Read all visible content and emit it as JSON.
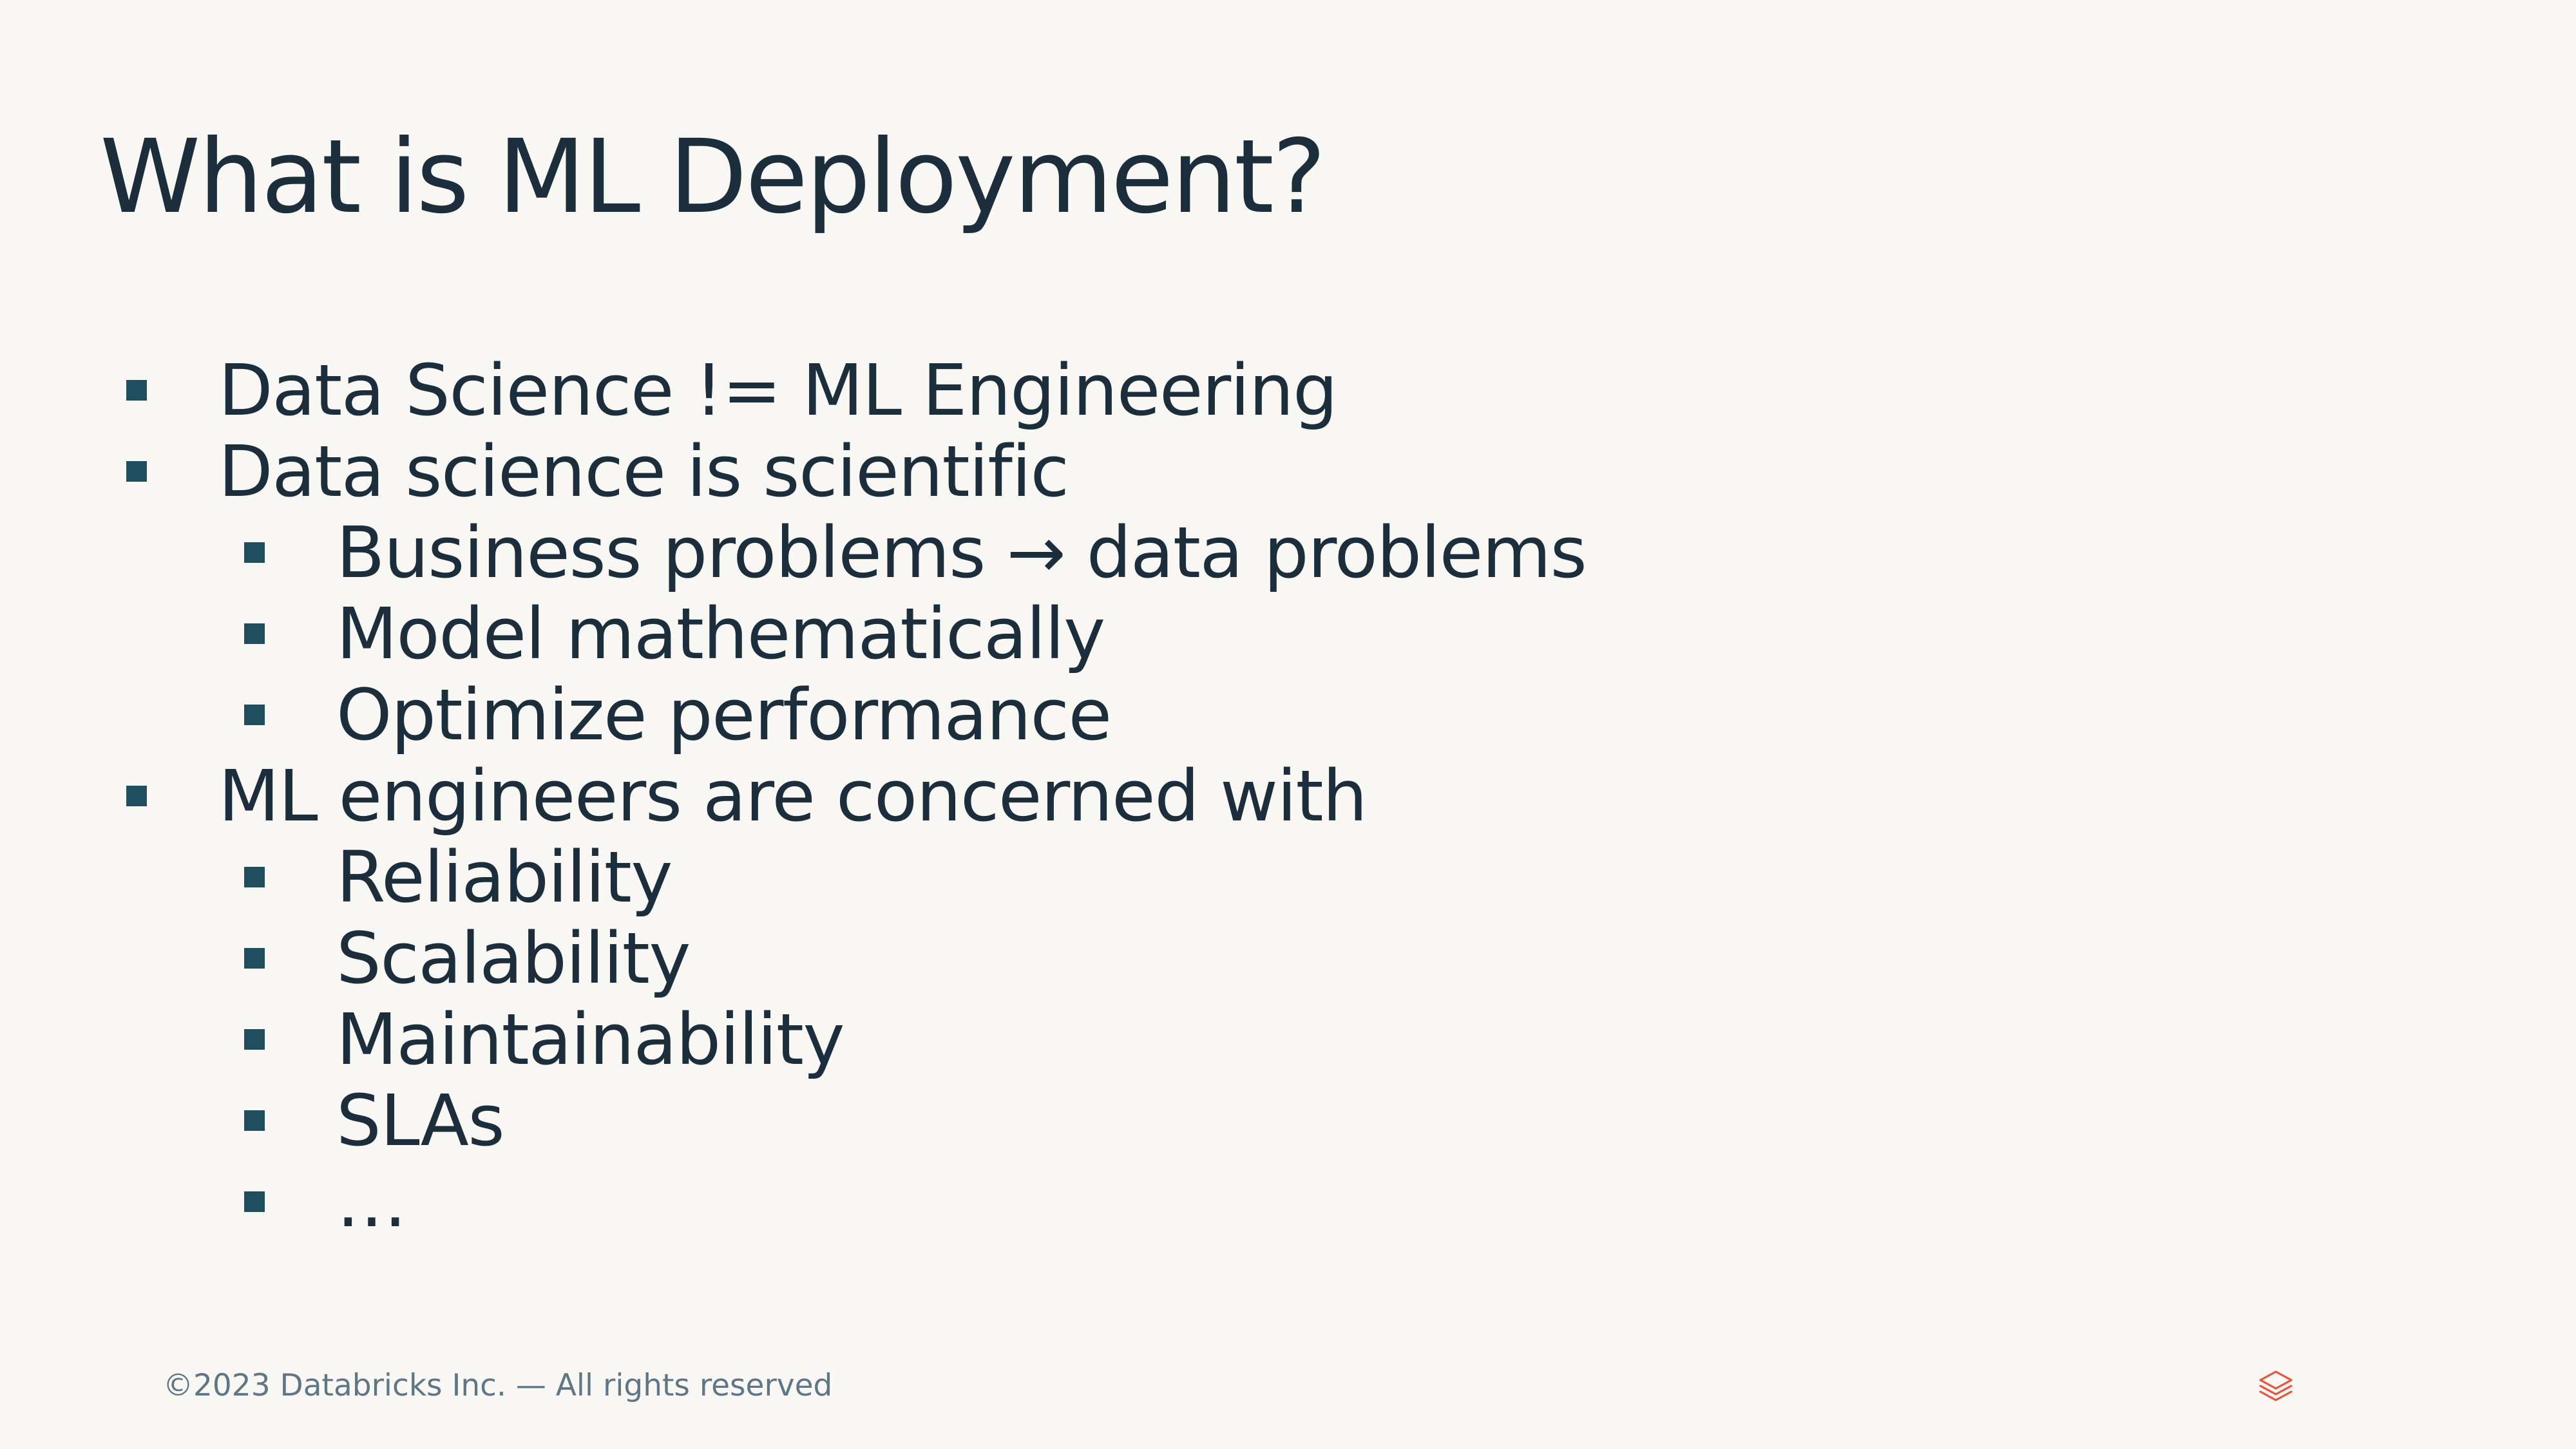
{
  "slide": {
    "title": "What is ML Deployment?",
    "bullets": [
      {
        "level": 1,
        "text": "Data Science != ML Engineering"
      },
      {
        "level": 1,
        "text": "Data science is scientific"
      },
      {
        "level": 2,
        "text": "Business problems → data problems"
      },
      {
        "level": 2,
        "text": "Model mathematically"
      },
      {
        "level": 2,
        "text": "Optimize performance"
      },
      {
        "level": 1,
        "text": "ML engineers are concerned with"
      },
      {
        "level": 2,
        "text": "Reliability"
      },
      {
        "level": 2,
        "text": "Scalability"
      },
      {
        "level": 2,
        "text": "Maintainability"
      },
      {
        "level": 2,
        "text": "SLAs"
      },
      {
        "level": 2,
        "text": "…"
      }
    ]
  },
  "footer": {
    "copyright": "©2023 Databricks Inc. — All rights reserved",
    "logo_icon": "databricks-logo-icon"
  },
  "colors": {
    "background": "#F8F7F4",
    "text": "#1C2D3B",
    "bullet": "#1F4E5F",
    "footer_text": "#5F7684",
    "logo": "#E8553F"
  }
}
